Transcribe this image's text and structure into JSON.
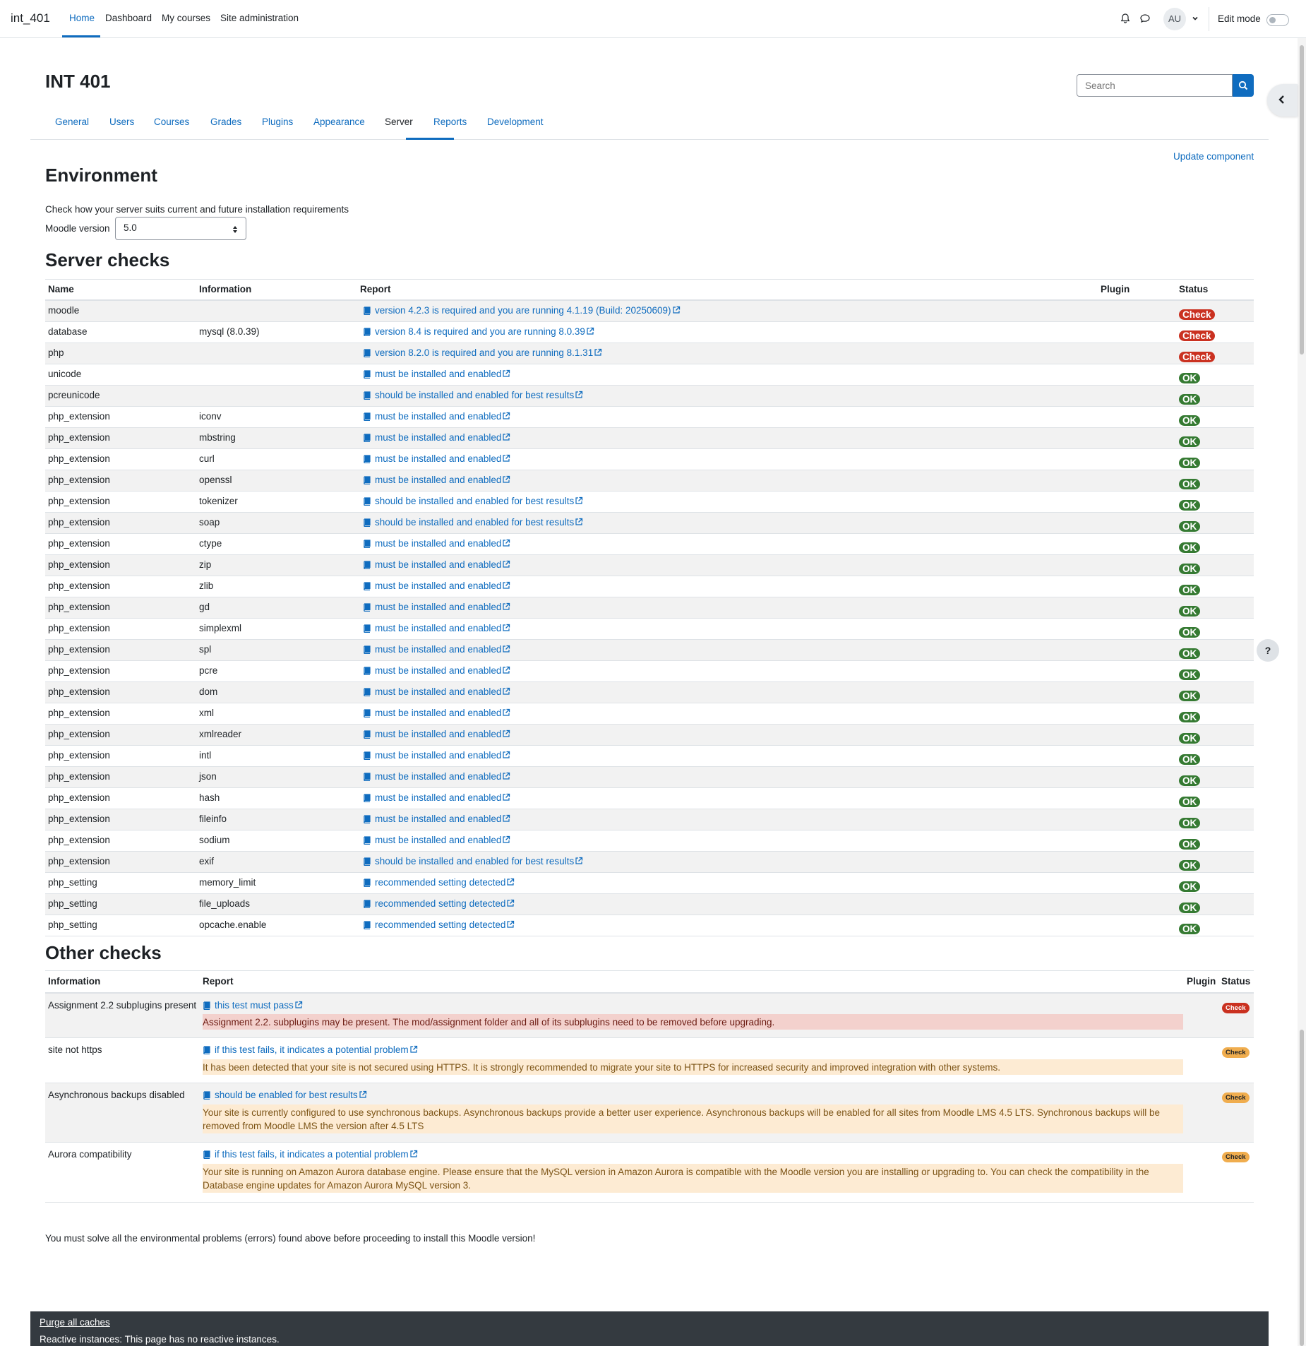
{
  "navbar": {
    "site_name": "int_401",
    "items": [
      "Home",
      "Dashboard",
      "My courses",
      "Site administration"
    ],
    "avatar_initials": "AU",
    "edit_mode_label": "Edit mode"
  },
  "header": {
    "title": "INT 401",
    "search_placeholder": "Search"
  },
  "admin_tabs": [
    "General",
    "Users",
    "Courses",
    "Grades",
    "Plugins",
    "Appearance",
    "Server",
    "Reports",
    "Development"
  ],
  "active_tab": "Server",
  "environment": {
    "update_component_link": "Update component",
    "heading": "Environment",
    "description": "Check how your server suits current and future installation requirements",
    "version_label": "Moodle version",
    "version_value": "5.0"
  },
  "server_checks": {
    "heading": "Server checks",
    "columns": [
      "Name",
      "Information",
      "Report",
      "Plugin",
      "Status"
    ],
    "rows": [
      {
        "name": "moodle",
        "info": "",
        "report": "version 4.2.3 is required and you are running 4.1.19 (Build: 20250609)",
        "plugin": "",
        "status": "Check",
        "level": "err"
      },
      {
        "name": "database",
        "info": "mysql (8.0.39)",
        "report": "version 8.4 is required and you are running 8.0.39",
        "plugin": "",
        "status": "Check",
        "level": "err"
      },
      {
        "name": "php",
        "info": "",
        "report": "version 8.2.0 is required and you are running 8.1.31",
        "plugin": "",
        "status": "Check",
        "level": "err"
      },
      {
        "name": "unicode",
        "info": "",
        "report": "must be installed and enabled",
        "plugin": "",
        "status": "OK",
        "level": "ok"
      },
      {
        "name": "pcreunicode",
        "info": "",
        "report": "should be installed and enabled for best results",
        "plugin": "",
        "status": "OK",
        "level": "ok"
      },
      {
        "name": "php_extension",
        "info": "iconv",
        "report": "must be installed and enabled",
        "plugin": "",
        "status": "OK",
        "level": "ok"
      },
      {
        "name": "php_extension",
        "info": "mbstring",
        "report": "must be installed and enabled",
        "plugin": "",
        "status": "OK",
        "level": "ok"
      },
      {
        "name": "php_extension",
        "info": "curl",
        "report": "must be installed and enabled",
        "plugin": "",
        "status": "OK",
        "level": "ok"
      },
      {
        "name": "php_extension",
        "info": "openssl",
        "report": "must be installed and enabled",
        "plugin": "",
        "status": "OK",
        "level": "ok"
      },
      {
        "name": "php_extension",
        "info": "tokenizer",
        "report": "should be installed and enabled for best results",
        "plugin": "",
        "status": "OK",
        "level": "ok"
      },
      {
        "name": "php_extension",
        "info": "soap",
        "report": "should be installed and enabled for best results",
        "plugin": "",
        "status": "OK",
        "level": "ok"
      },
      {
        "name": "php_extension",
        "info": "ctype",
        "report": "must be installed and enabled",
        "plugin": "",
        "status": "OK",
        "level": "ok"
      },
      {
        "name": "php_extension",
        "info": "zip",
        "report": "must be installed and enabled",
        "plugin": "",
        "status": "OK",
        "level": "ok"
      },
      {
        "name": "php_extension",
        "info": "zlib",
        "report": "must be installed and enabled",
        "plugin": "",
        "status": "OK",
        "level": "ok"
      },
      {
        "name": "php_extension",
        "info": "gd",
        "report": "must be installed and enabled",
        "plugin": "",
        "status": "OK",
        "level": "ok"
      },
      {
        "name": "php_extension",
        "info": "simplexml",
        "report": "must be installed and enabled",
        "plugin": "",
        "status": "OK",
        "level": "ok"
      },
      {
        "name": "php_extension",
        "info": "spl",
        "report": "must be installed and enabled",
        "plugin": "",
        "status": "OK",
        "level": "ok"
      },
      {
        "name": "php_extension",
        "info": "pcre",
        "report": "must be installed and enabled",
        "plugin": "",
        "status": "OK",
        "level": "ok"
      },
      {
        "name": "php_extension",
        "info": "dom",
        "report": "must be installed and enabled",
        "plugin": "",
        "status": "OK",
        "level": "ok"
      },
      {
        "name": "php_extension",
        "info": "xml",
        "report": "must be installed and enabled",
        "plugin": "",
        "status": "OK",
        "level": "ok"
      },
      {
        "name": "php_extension",
        "info": "xmlreader",
        "report": "must be installed and enabled",
        "plugin": "",
        "status": "OK",
        "level": "ok"
      },
      {
        "name": "php_extension",
        "info": "intl",
        "report": "must be installed and enabled",
        "plugin": "",
        "status": "OK",
        "level": "ok"
      },
      {
        "name": "php_extension",
        "info": "json",
        "report": "must be installed and enabled",
        "plugin": "",
        "status": "OK",
        "level": "ok"
      },
      {
        "name": "php_extension",
        "info": "hash",
        "report": "must be installed and enabled",
        "plugin": "",
        "status": "OK",
        "level": "ok"
      },
      {
        "name": "php_extension",
        "info": "fileinfo",
        "report": "must be installed and enabled",
        "plugin": "",
        "status": "OK",
        "level": "ok"
      },
      {
        "name": "php_extension",
        "info": "sodium",
        "report": "must be installed and enabled",
        "plugin": "",
        "status": "OK",
        "level": "ok"
      },
      {
        "name": "php_extension",
        "info": "exif",
        "report": "should be installed and enabled for best results",
        "plugin": "",
        "status": "OK",
        "level": "ok"
      },
      {
        "name": "php_setting",
        "info": "memory_limit",
        "report": "recommended setting detected",
        "plugin": "",
        "status": "OK",
        "level": "ok"
      },
      {
        "name": "php_setting",
        "info": "file_uploads",
        "report": "recommended setting detected",
        "plugin": "",
        "status": "OK",
        "level": "ok"
      },
      {
        "name": "php_setting",
        "info": "opcache.enable",
        "report": "recommended setting detected",
        "plugin": "",
        "status": "OK",
        "level": "ok"
      }
    ]
  },
  "other_checks": {
    "heading": "Other checks",
    "columns": [
      "Information",
      "Report",
      "Plugin",
      "Status"
    ],
    "rows": [
      {
        "info": "Assignment 2.2 subplugins present",
        "report": "this test must pass",
        "message": "Assignment 2.2. subplugins may be present. The mod/assignment folder and all of its subplugins need to be removed before upgrading.",
        "status": "Check",
        "level": "err"
      },
      {
        "info": "site not https",
        "report": "if this test fails, it indicates a potential problem",
        "message": "It has been detected that your site is not secured using HTTPS. It is strongly recommended to migrate your site to HTTPS for increased security and improved integration with other systems.",
        "status": "Check",
        "level": "warn"
      },
      {
        "info": "Asynchronous backups disabled",
        "report": "should be enabled for best results",
        "message": "Your site is currently configured to use synchronous backups. Asynchronous backups provide a better user experience. Asynchronous backups will be enabled for all sites from Moodle LMS 4.5 LTS. Synchronous backups will be removed from Moodle LMS the version after 4.5 LTS",
        "status": "Check",
        "level": "warn"
      },
      {
        "info": "Aurora compatibility",
        "report": "if this test fails, it indicates a potential problem",
        "message": "Your site is running on Amazon Aurora database engine. Please ensure that the MySQL version in Amazon Aurora is compatible with the Moodle version you are installing or upgrading to. You can check the compatibility in the Database engine updates for Amazon Aurora MySQL version 3.",
        "status": "Check",
        "level": "warn"
      }
    ]
  },
  "final_note": "You must solve all the environmental problems (errors) found above before proceeding to install this Moodle version!",
  "footer": {
    "purge_link": "Purge all caches",
    "reactive_note": "Reactive instances: This page has no reactive instances."
  },
  "help_button_label": "?",
  "colors": {
    "link": "#0f6cbf",
    "error": "#ca3120",
    "ok": "#357a32",
    "warning": "#f0ad4e",
    "footer_bg": "#343a40"
  }
}
